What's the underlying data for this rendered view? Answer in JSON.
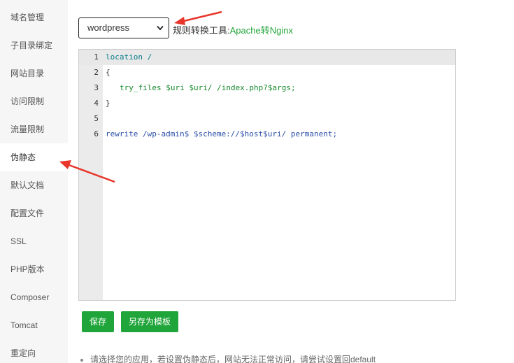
{
  "sidebar": {
    "items": [
      {
        "label": "域名管理"
      },
      {
        "label": "子目录绑定"
      },
      {
        "label": "网站目录"
      },
      {
        "label": "访问限制"
      },
      {
        "label": "流量限制"
      },
      {
        "label": "伪静态"
      },
      {
        "label": "默认文档"
      },
      {
        "label": "配置文件"
      },
      {
        "label": "SSL"
      },
      {
        "label": "PHP版本"
      },
      {
        "label": "Composer"
      },
      {
        "label": "Tomcat"
      },
      {
        "label": "重定向"
      }
    ],
    "active_index": 5
  },
  "rewrite": {
    "template_select": {
      "value": "wordpress"
    },
    "tool_label": "规则转换工具:",
    "tool_link": "Apache转Nginx"
  },
  "editor": {
    "lines": [
      {
        "num": "1",
        "text": "location /"
      },
      {
        "num": "2",
        "text": "{"
      },
      {
        "num": "3",
        "text": "try_files $uri $uri/ /index.php?$args;"
      },
      {
        "num": "4",
        "text": "}"
      },
      {
        "num": "5",
        "text": ""
      },
      {
        "num": "6",
        "text": "rewrite /wp-admin$ $scheme://$host$uri/ permanent;"
      }
    ]
  },
  "buttons": {
    "save_label": "保存",
    "save_template_label": "另存为模板"
  },
  "tips": {
    "text": "请选择您的应用，若设置伪静态后，网站无法正常访问，请尝试设置回default"
  },
  "colors": {
    "accent": "#20a53a",
    "annotation_arrow": "#e8362b"
  }
}
